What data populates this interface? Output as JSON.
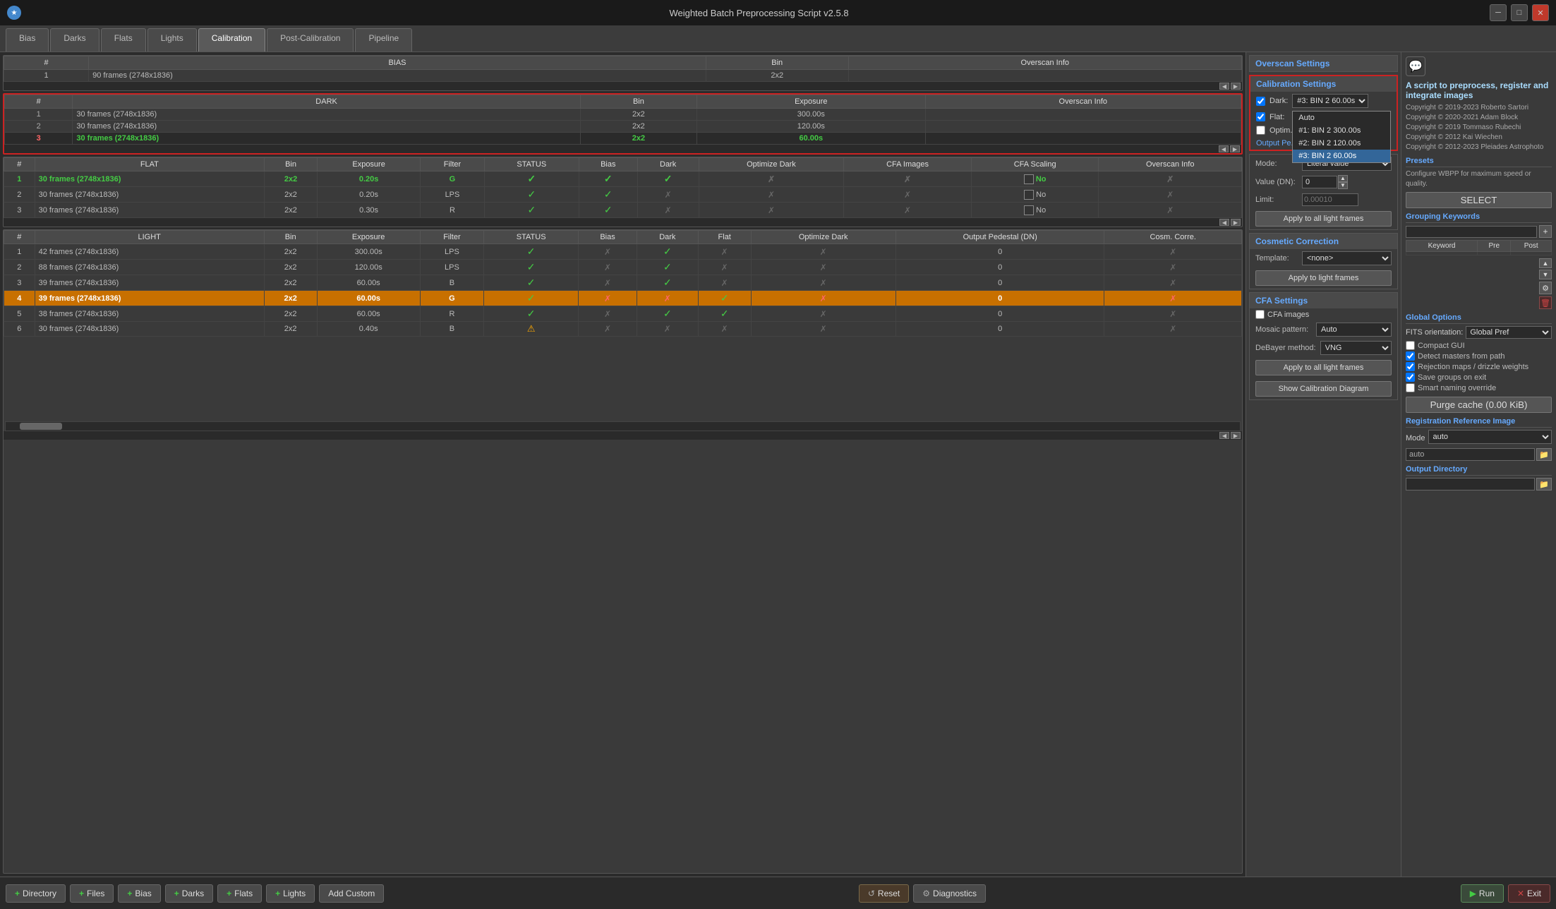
{
  "window": {
    "title": "Weighted Batch Preprocessing Script v2.5.8",
    "icon": "★"
  },
  "tabs": [
    {
      "label": "Bias",
      "active": false
    },
    {
      "label": "Darks",
      "active": false
    },
    {
      "label": "Flats",
      "active": false
    },
    {
      "label": "Lights",
      "active": false
    },
    {
      "label": "Calibration",
      "active": true
    },
    {
      "label": "Post-Calibration",
      "active": false
    },
    {
      "label": "Pipeline",
      "active": false
    }
  ],
  "bias_table": {
    "headers": [
      "#",
      "BIAS",
      "Bin",
      "Overscan Info"
    ],
    "rows": [
      {
        "num": "1",
        "name": "90 frames (2748x1836)",
        "bin": "2x2",
        "overscan": ""
      }
    ]
  },
  "dark_table": {
    "headers": [
      "#",
      "DARK",
      "Bin",
      "Exposure",
      "Overscan Info"
    ],
    "rows": [
      {
        "num": "1",
        "name": "30 frames (2748x1836)",
        "bin": "2x2",
        "exposure": "300.00s",
        "overscan": "",
        "highlight": false
      },
      {
        "num": "2",
        "name": "30 frames (2748x1836)",
        "bin": "2x2",
        "exposure": "120.00s",
        "overscan": "",
        "highlight": false
      },
      {
        "num": "3",
        "name": "30 frames (2748x1836)",
        "bin": "2x2",
        "exposure": "60.00s",
        "overscan": "",
        "highlight": true
      }
    ]
  },
  "flat_table": {
    "headers": [
      "#",
      "FLAT",
      "Bin",
      "Exposure",
      "Filter",
      "STATUS",
      "Bias",
      "Dark",
      "Optimize Dark",
      "CFA Images",
      "CFA Scaling",
      "Overscan Info"
    ],
    "rows": [
      {
        "num": "1",
        "name": "30 frames (2748x1836)",
        "bin": "2x2",
        "exposure": "0.20s",
        "filter": "G",
        "status": "✓",
        "bias": "✓",
        "dark": "✓",
        "optdark": "✗",
        "cfa_img": "✗",
        "cfa_scl": "No",
        "overscan": "✗",
        "highlight": true
      },
      {
        "num": "2",
        "name": "30 frames (2748x1836)",
        "bin": "2x2",
        "exposure": "0.20s",
        "filter": "LPS",
        "status": "✓",
        "bias": "✓",
        "dark": "✗",
        "optdark": "✗",
        "cfa_img": "✗",
        "cfa_scl": "No",
        "overscan": "✗",
        "highlight": false
      },
      {
        "num": "3",
        "name": "30 frames (2748x1836)",
        "bin": "2x2",
        "exposure": "0.30s",
        "filter": "R",
        "status": "✓",
        "bias": "✓",
        "dark": "✗",
        "optdark": "✗",
        "cfa_img": "✗",
        "cfa_scl": "No",
        "overscan": "✗",
        "highlight": false
      }
    ]
  },
  "light_table": {
    "headers": [
      "#",
      "LIGHT",
      "Bin",
      "Exposure",
      "Filter",
      "STATUS",
      "Bias",
      "Dark",
      "Flat",
      "Optimize Dark",
      "Output Pedestal (DN)",
      "Cosm. Corre."
    ],
    "rows": [
      {
        "num": "1",
        "name": "42 frames (2748x1836)",
        "bin": "2x2",
        "exposure": "300.00s",
        "filter": "LPS",
        "status": "✓",
        "bias": "✗",
        "dark": "✓",
        "flat": "✗",
        "optdark": "✗",
        "pedestal": "0",
        "cosm": "✗",
        "highlight": false
      },
      {
        "num": "2",
        "name": "88 frames (2748x1836)",
        "bin": "2x2",
        "exposure": "120.00s",
        "filter": "LPS",
        "status": "✓",
        "bias": "✗",
        "dark": "✓",
        "flat": "✗",
        "optdark": "✗",
        "pedestal": "0",
        "cosm": "✗",
        "highlight": false
      },
      {
        "num": "3",
        "name": "39 frames (2748x1836)",
        "bin": "2x2",
        "exposure": "60.00s",
        "filter": "B",
        "status": "✓",
        "bias": "✗",
        "dark": "✓",
        "flat": "✗",
        "optdark": "✗",
        "pedestal": "0",
        "cosm": "✗",
        "highlight": false
      },
      {
        "num": "4",
        "name": "39 frames (2748x1836)",
        "bin": "2x2",
        "exposure": "60.00s",
        "filter": "G",
        "status": "✓",
        "bias": "✗",
        "dark": "✗",
        "flat": "✓",
        "optdark": "✗",
        "pedestal": "0",
        "cosm": "✗",
        "highlight": true
      },
      {
        "num": "5",
        "name": "38 frames (2748x1836)",
        "bin": "2x2",
        "exposure": "60.00s",
        "filter": "R",
        "status": "✓",
        "bias": "✗",
        "dark": "✓",
        "flat": "✓",
        "optdark": "✗",
        "pedestal": "0",
        "cosm": "✗",
        "highlight": false
      },
      {
        "num": "6",
        "name": "30 frames (2748x1836)",
        "bin": "2x2",
        "exposure": "0.40s",
        "filter": "B",
        "status": "⚠",
        "bias": "✗",
        "dark": "✗",
        "flat": "✗",
        "optdark": "✗",
        "pedestal": "0",
        "cosm": "✗",
        "highlight": false
      }
    ]
  },
  "calibration_settings": {
    "header": "Calibration Settings",
    "dark_checked": true,
    "dark_label": "Dark:",
    "dark_value": "Auto",
    "flat_checked": true,
    "flat_label": "Flat:",
    "optimize_checked": false,
    "optimize_label": "Optim...",
    "dropdown_options": [
      "Auto",
      "#1: BIN 2  300.00s",
      "#2: BIN 2  120.00s",
      "#3: BIN 2  60.00s"
    ],
    "selected_option": "#3: BIN 2  60.00s",
    "output_pedestal_label": "Output Pe..."
  },
  "output_pedestal": {
    "header": "Output Pedestal",
    "mode_label": "Mode:",
    "mode_value": "Literal value",
    "value_label": "Value (DN):",
    "value": "0",
    "limit_label": "Limit:",
    "limit_value": "0.00010",
    "apply_btn": "Apply to all light frames"
  },
  "cosmetic_correction": {
    "header": "Cosmetic Correction",
    "template_label": "Template:",
    "template_value": "<none>",
    "apply_btn": "Apply to light frames"
  },
  "cfa_settings": {
    "header": "CFA Settings",
    "cfa_images_label": "CFA images",
    "cfa_images_checked": false,
    "mosaic_label": "Mosaic pattern:",
    "mosaic_value": "Auto",
    "debayer_label": "DeBayer method:",
    "debayer_value": "VNG",
    "apply_btn": "Apply to all light frames",
    "show_cal_btn": "Show Calibration Diagram"
  },
  "overscan_settings": {
    "header": "Overscan Settings"
  },
  "right_panel": {
    "title": "A script to preprocess, register and integrate images",
    "copyright": "Copyright © 2019-2023 Roberto Sartori\nCopyright © 2020-2021 Adam Block\nCopyright © 2019 Tommaso Rubechi\nCopyright © 2012 Kai Wiechen\nCopyright © 2012-2023 Pleiades Astrophoto",
    "presets_header": "Presets",
    "presets_desc": "Configure WBPP for maximum speed or quality.",
    "select_btn": "SELECT",
    "grouping_header": "Grouping Keywords",
    "keyword_col": "Keyword",
    "pre_col": "Pre",
    "post_col": "Post",
    "global_header": "Global Options",
    "fits_label": "FITS orientation:",
    "fits_value": "Global Pref",
    "compact_gui_label": "Compact GUI",
    "compact_gui_checked": false,
    "detect_masters_label": "Detect masters from path",
    "detect_masters_checked": true,
    "rejection_maps_label": "Rejection maps / drizzle weights",
    "rejection_maps_checked": true,
    "save_groups_label": "Save groups on exit",
    "save_groups_checked": true,
    "smart_naming_label": "Smart naming override",
    "smart_naming_checked": false,
    "purge_cache_btn": "Purge cache (0.00 KiB)",
    "reg_ref_header": "Registration Reference Image",
    "reg_mode_label": "Mode",
    "reg_mode_value": "auto",
    "reg_input_value": "auto",
    "output_dir_header": "Output Directory"
  },
  "bottom_bar": {
    "directory_btn": "+ Directory",
    "files_btn": "+ Files",
    "bias_btn": "+ Bias",
    "darks_btn": "+ Darks",
    "flats_btn": "+ Flats",
    "lights_btn": "+ Lights",
    "custom_btn": "Add Custom",
    "reset_btn": "Reset",
    "diagnostics_btn": "Diagnostics",
    "run_btn": "Run",
    "exit_btn": "Exit"
  }
}
